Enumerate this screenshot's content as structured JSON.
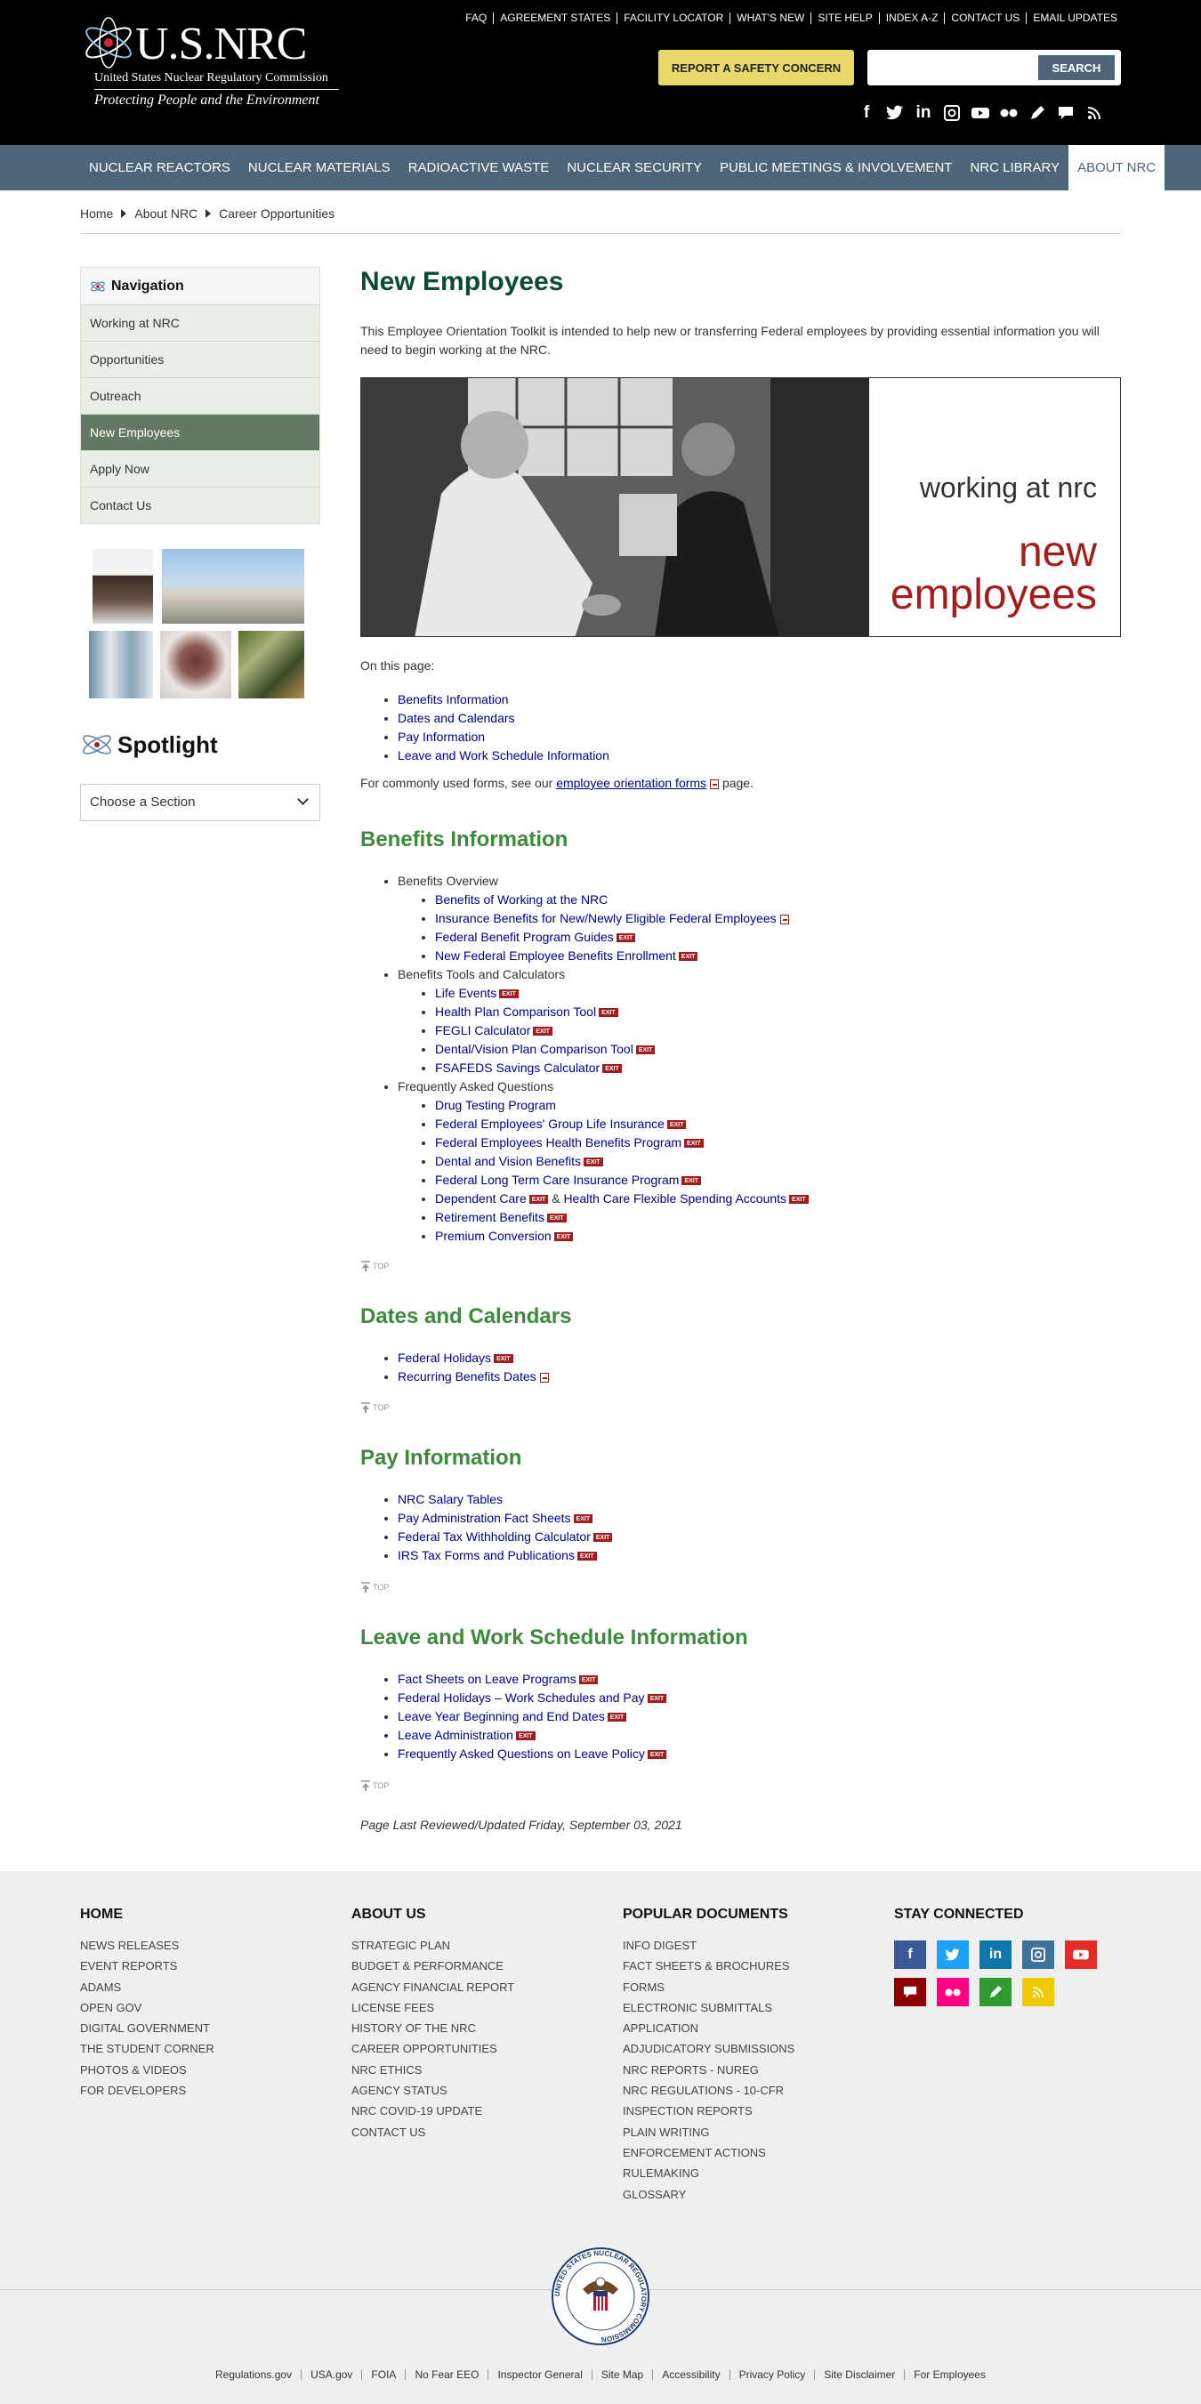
{
  "header": {
    "logo_title": "U.S.NRC",
    "logo_subtitle": "United States Nuclear Regulatory Commission",
    "logo_tagline": "Protecting People and the Environment",
    "util_links": [
      "FAQ",
      "AGREEMENT STATES",
      "FACILITY LOCATOR",
      "WHAT'S NEW",
      "SITE HELP",
      "INDEX A-Z",
      "CONTACT US",
      "EMAIL UPDATES"
    ],
    "safety_button": "REPORT A SAFETY CONCERN",
    "search_placeholder": "",
    "search_button": "SEARCH",
    "social_icons": [
      "facebook-icon",
      "twitter-icon",
      "linkedin-icon",
      "instagram-icon",
      "youtube-icon",
      "flickr-icon",
      "pencil-icon",
      "comment-icon",
      "rss-icon"
    ]
  },
  "mainnav": [
    "NUCLEAR REACTORS",
    "NUCLEAR MATERIALS",
    "RADIOACTIVE WASTE",
    "NUCLEAR SECURITY",
    "PUBLIC MEETINGS & INVOLVEMENT",
    "NRC LIBRARY",
    "ABOUT NRC"
  ],
  "breadcrumb": [
    "Home",
    "About NRC",
    "Career Opportunities"
  ],
  "sidebar": {
    "heading": "Navigation",
    "items": [
      "Working at NRC",
      "Opportunities",
      "Outreach",
      "New Employees",
      "Apply Now",
      "Contact Us"
    ],
    "active_index": 3,
    "spotlight_title": "Spotlight",
    "select_value": "Choose a Section"
  },
  "content": {
    "title": "New Employees",
    "intro": "This Employee Orientation Toolkit is intended to help new or transferring Federal employees by providing essential information you will need to begin working at the NRC.",
    "hero_line1": "working at nrc",
    "hero_line2": "new",
    "hero_line3": "employees",
    "on_page_label": "On this page:",
    "toc": [
      "Benefits Information",
      "Dates and Calendars",
      "Pay Information",
      "Leave and Work Schedule Information"
    ],
    "forms_prefix": "For commonly used forms, see our",
    "forms_link": "employee orientation forms",
    "forms_suffix": "page.",
    "exit_label": "EXIT",
    "top_label": "TOP",
    "benefits": {
      "title": "Benefits Information",
      "groups": [
        {
          "label": "Benefits Overview",
          "links": [
            "Benefits of Working at the NRC",
            "Insurance Benefits for New/Newly Eligible Federal Employees",
            "Federal Benefit Program Guides",
            "New Federal Employee Benefits Enrollment"
          ]
        },
        {
          "label": "Benefits Tools and Calculators",
          "links": [
            "Life Events",
            "Health Plan Comparison Tool",
            "FEGLI Calculator",
            "Dental/Vision Plan Comparison Tool",
            "FSAFEDS Savings Calculator"
          ]
        },
        {
          "label": "Frequently Asked Questions",
          "links": [
            "Drug Testing Program",
            "Federal Employees' Group Life Insurance",
            "Federal Employees Health Benefits Program",
            "Dental and Vision Benefits",
            "Federal Long Term Care Insurance Program",
            "Dependent Care",
            "&",
            "Health Care Flexible Spending Accounts",
            "Retirement Benefits",
            "Premium Conversion"
          ]
        }
      ]
    },
    "dates": {
      "title": "Dates and Calendars",
      "links": [
        "Federal Holidays",
        "Recurring Benefits Dates"
      ]
    },
    "pay": {
      "title": "Pay Information",
      "links": [
        "NRC Salary Tables",
        "Pay Administration Fact Sheets",
        "Federal Tax Withholding Calculator",
        "IRS Tax Forms and Publications"
      ]
    },
    "leave": {
      "title": "Leave and Work Schedule Information",
      "links": [
        "Fact Sheets on Leave Programs",
        "Federal Holidays – Work Schedules and Pay",
        "Leave Year Beginning and End Dates",
        "Leave Administration",
        "Frequently Asked Questions on Leave Policy"
      ]
    },
    "reviewed": "Page Last Reviewed/Updated Friday, September 03, 2021"
  },
  "footer": {
    "home": {
      "title": "HOME",
      "links": [
        "NEWS RELEASES",
        "EVENT REPORTS",
        "ADAMS",
        "OPEN GOV",
        "DIGITAL GOVERNMENT",
        "THE STUDENT CORNER",
        "PHOTOS & VIDEOS",
        "FOR DEVELOPERS"
      ]
    },
    "about": {
      "title": "ABOUT US",
      "links": [
        "STRATEGIC PLAN",
        "BUDGET & PERFORMANCE",
        "AGENCY FINANCIAL REPORT",
        "LICENSE FEES",
        "HISTORY OF THE NRC",
        "CAREER OPPORTUNITIES",
        "NRC ETHICS",
        "AGENCY STATUS",
        "NRC COVID-19 UPDATE",
        "CONTACT US"
      ]
    },
    "popular": {
      "title": "POPULAR DOCUMENTS",
      "links": [
        "INFO DIGEST",
        "FACT SHEETS & BROCHURES",
        "FORMS",
        "ELECTRONIC SUBMITTALS",
        "APPLICATION",
        "ADJUDICATORY SUBMISSIONS",
        "NRC REPORTS - NUREG",
        "NRC REGULATIONS - 10-CFR",
        "INSPECTION REPORTS",
        "PLAIN WRITING",
        "ENFORCEMENT ACTIONS",
        "RULEMAKING",
        "GLOSSARY"
      ]
    },
    "stay": {
      "title": "STAY CONNECTED"
    },
    "seal_text": "UNITED STATES NUCLEAR REGULATORY COMMISSION",
    "bottom_links": [
      "Regulations.gov",
      "USA.gov",
      "FOIA",
      "No Fear EEO",
      "Inspector General",
      "Site Map",
      "Accessibility",
      "Privacy Policy",
      "Site Disclaimer",
      "For Employees"
    ]
  },
  "colors": {
    "header_bg": "#000000",
    "nav_bg": "#4c6579",
    "title_green": "#0c4a38",
    "section_green": "#3d8a3d",
    "link_blue": "#00008b",
    "exit_red": "#a51c1c",
    "safety_yellow": "#e8d96a"
  }
}
